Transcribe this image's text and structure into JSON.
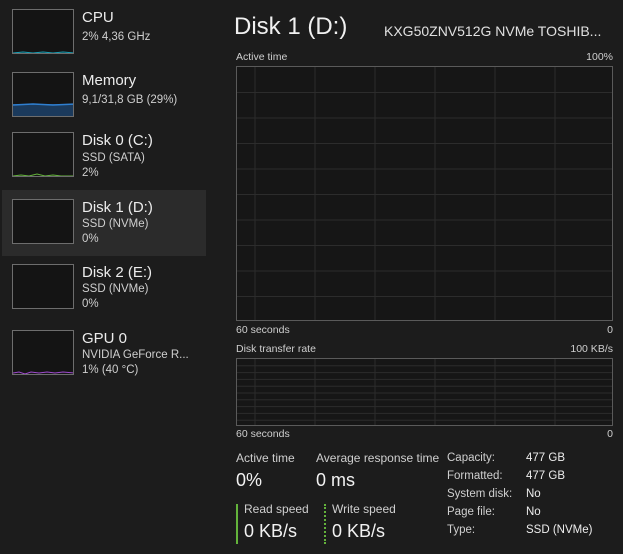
{
  "sidebar": {
    "items": [
      {
        "title": "CPU",
        "sub1": "2% 4,36 GHz",
        "sub2": "",
        "color": "#17a2b8"
      },
      {
        "title": "Memory",
        "sub1": "9,1/31,8 GB (29%)",
        "sub2": "",
        "color": "#2f7fd0"
      },
      {
        "title": "Disk 0 (C:)",
        "sub1": "SSD (SATA)",
        "sub2": "2%",
        "color": "#63b33b"
      },
      {
        "title": "Disk 1 (D:)",
        "sub1": "SSD (NVMe)",
        "sub2": "0%",
        "color": "#63b33b"
      },
      {
        "title": "Disk 2 (E:)",
        "sub1": "SSD (NVMe)",
        "sub2": "0%",
        "color": "#63b33b"
      },
      {
        "title": "GPU 0",
        "sub1": "NVIDIA GeForce R...",
        "sub2": "1% (40 °C)",
        "color": "#a04bd0"
      }
    ],
    "selected_index": 3
  },
  "header": {
    "title": "Disk 1 (D:)",
    "model": "KXG50ZNV512G NVMe TOSHIB..."
  },
  "active_graph": {
    "label": "Active time",
    "max": "100%",
    "x_label": "60 seconds",
    "min": "0"
  },
  "transfer_graph": {
    "label": "Disk transfer rate",
    "max": "100 KB/s",
    "x_label": "60 seconds",
    "min": "0"
  },
  "stats": {
    "active_time_label": "Active time",
    "active_time_value": "0%",
    "avg_response_label": "Average response time",
    "avg_response_value": "0 ms",
    "read_speed_label": "Read speed",
    "read_speed_value": "0 KB/s",
    "write_speed_label": "Write speed",
    "write_speed_value": "0 KB/s",
    "read_color": "#63b33b",
    "write_color": "#63b33b"
  },
  "info": [
    {
      "key": "Capacity:",
      "value": "477 GB"
    },
    {
      "key": "Formatted:",
      "value": "477 GB"
    },
    {
      "key": "System disk:",
      "value": "No"
    },
    {
      "key": "Page file:",
      "value": "No"
    },
    {
      "key": "Type:",
      "value": "SSD (NVMe)"
    }
  ]
}
